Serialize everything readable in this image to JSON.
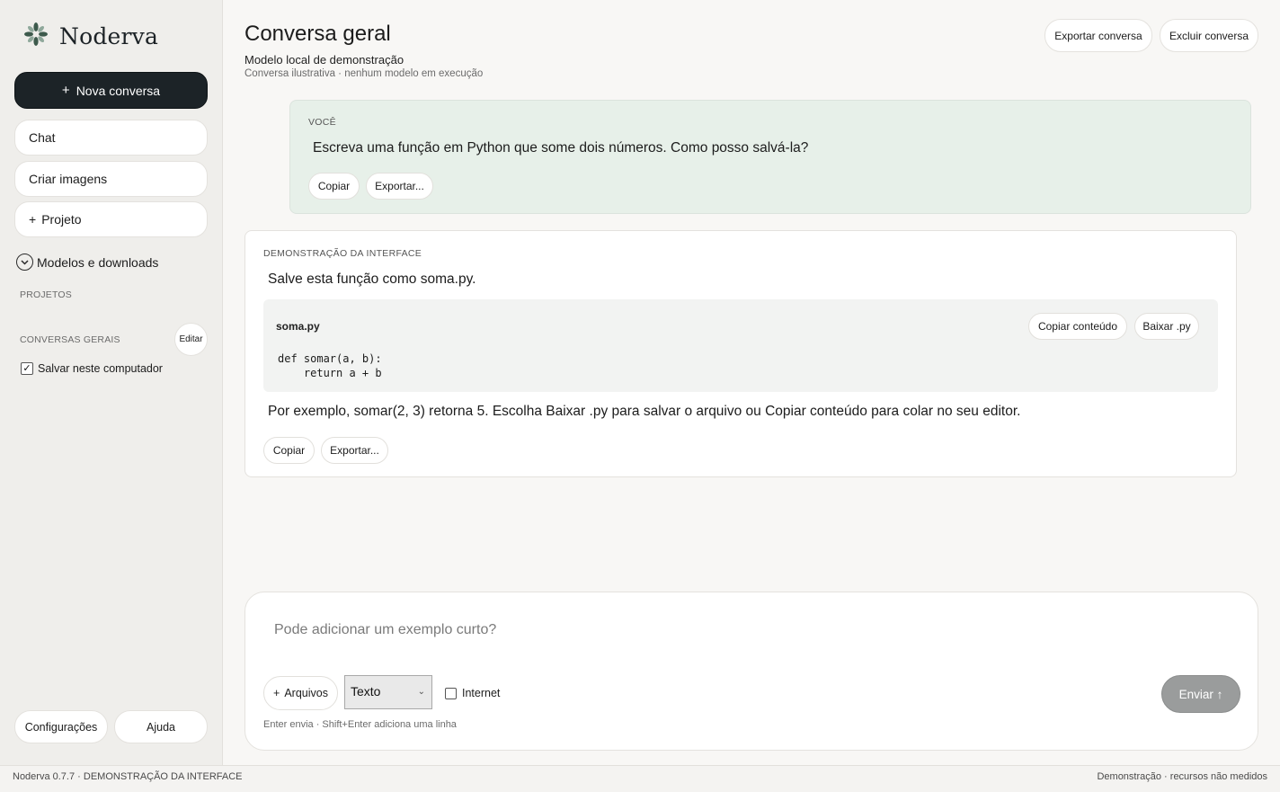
{
  "app": {
    "brand_name": "Noderva",
    "brand_color": "#3d5a4c"
  },
  "sidebar": {
    "new_chat_label": "Nova conversa",
    "nav": [
      {
        "label": "Chat"
      },
      {
        "label": "Criar imagens"
      },
      {
        "label": "Projeto"
      }
    ],
    "models_label": "Modelos e downloads",
    "projects_heading": "PROJETOS",
    "general_heading": "CONVERSAS GERAIS",
    "edit_label": "Editar",
    "save_checkbox": {
      "label": "Salvar neste computador",
      "checked": true
    },
    "settings_label": "Configurações",
    "help_label": "Ajuda"
  },
  "header": {
    "title": "Conversa geral",
    "subtitle": "Modelo local de demonstração",
    "caption": "Conversa ilustrativa · nenhum modelo em execução",
    "export_label": "Exportar conversa",
    "delete_label": "Excluir conversa"
  },
  "messages": {
    "user": {
      "role": "VOCÊ",
      "text": "Escreva uma função em Python que some dois números. Como posso salvá-la?",
      "copy_label": "Copiar",
      "export_label": "Exportar..."
    },
    "assistant": {
      "role": "DEMONSTRAÇÃO DA INTERFACE",
      "intro": "Salve esta função como soma.py.",
      "code": {
        "filename": "soma.py",
        "copy_label": "Copiar conteúdo",
        "download_label": "Baixar .py",
        "content": "def somar(a, b):\n    return a + b"
      },
      "outro": "Por exemplo, somar(2, 3) retorna 5. Escolha Baixar .py para salvar o arquivo ou Copiar conteúdo para colar no seu editor.",
      "copy_label": "Copiar",
      "export_label": "Exportar..."
    }
  },
  "composer": {
    "placeholder": "Pode adicionar um exemplo curto?",
    "attach_label": "Arquivos",
    "mode_value": "Texto",
    "internet_label": "Internet",
    "internet_checked": false,
    "send_label": "Enviar ↑",
    "hint": "Enter envia · Shift+Enter adiciona uma linha"
  },
  "status": {
    "left": "Noderva 0.7.7 · DEMONSTRAÇÃO DA INTERFACE",
    "right": "Demonstração · recursos não medidos"
  }
}
